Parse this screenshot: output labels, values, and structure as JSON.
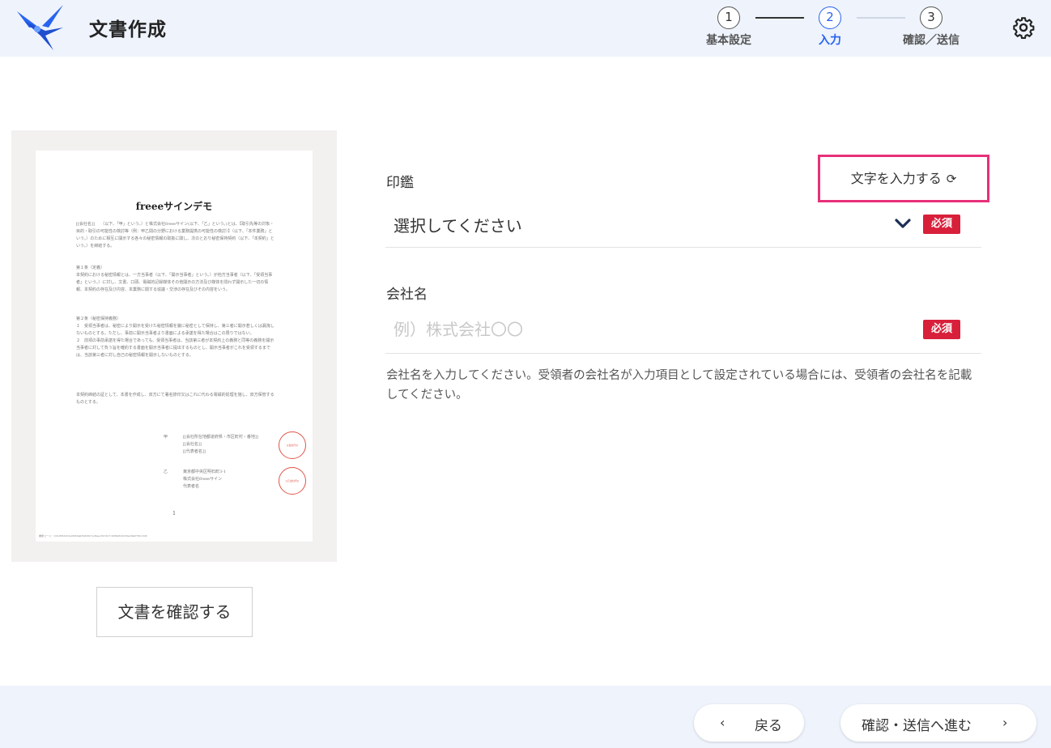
{
  "header": {
    "app_title": "文書作成",
    "steps": [
      {
        "number": "1",
        "label": "基本設定"
      },
      {
        "number": "2",
        "label": "入力"
      },
      {
        "number": "3",
        "label": "確認／送信"
      }
    ],
    "active_step": 2,
    "accent_color": "#2864f0"
  },
  "preview": {
    "doc_title": "freeeサインデモ",
    "paragraphs": [
      "[[会社名]]　　（以下、「甲」という。）と株式会社freeeサイン(以下、「乙」という。)とは、【取引先等の対象・目的・取引の可能性の検討等（例：甲乙間の分野における業務提携の可能性の検討）】（以下、「本件業務」という。）のために相互に開示する各々の秘密情報の取扱に関し、次のとおり秘密保持契約（以下、「本契約」という。）を締結する。",
      "第１条（定義）\n本契約における秘密情報とは、一方当事者（以下、「開示当事者」という。）が他方当事者（以下、「受領当事者」という。）に対し、文書、口頭、電磁的記録媒体その他開示の方法及び媒体を問わず開示した一切の情報、本契約の存在及び内容、本業務に関する協議・交渉の存在及びその内容をいう。",
      "第２条（秘密保持義務）\n１　受領当事者は、秘密により開示を受けた秘密情報を厳に秘密として保持し、第三者に開示若しくは漏洩しないものとする。ただし、事前に開示当事者より書面による承諾を得た場合はこの限りではない。\n２　前項の事前承諾を得た場合であっても、受領当事者は、当該第三者が本契約上の義務と同等の義務を開示当事者に対して負う旨を確約する書面を開示当事者に提出するものとし、開示当事者がこれを受領するまでは、当該第三者に対し自己の秘密情報を開示しないものとする。",
      "本契約締結の証として、本書を作成し、双方にて署名捺印又はこれに代わる電磁的処理を施し、双方保管するものとする。"
    ],
    "party_a_mark": "甲",
    "party_a_lines": [
      "[[会社所在地都道府県・市区町村・番地]]",
      "[[会社名]]",
      "[[代表者名]]"
    ],
    "party_b_mark": "乙",
    "party_b_lines": [
      "東京都中央区明石町3-1",
      "株式会社freeeサイン",
      "代表者名"
    ],
    "stamp_a_text": "[[会社印]]",
    "stamp_b_text": "[[乙会社印]]",
    "page_number": "1",
    "footer_id": "書類コード：10bc8f6d2b5e08f2fa4f3b8d6b7ed6eac8b7427c96f8a5b5d39a28a0f78bc6d6"
  },
  "confirm_doc_button": "文書を確認する",
  "form": {
    "seal": {
      "label": "印鑑",
      "type_text_button": "文字を入力する",
      "value": "選択してください",
      "required_badge": "必須"
    },
    "company": {
      "label": "会社名",
      "placeholder": "例）株式会社〇〇",
      "value": "",
      "required_badge": "必須",
      "help": "会社名を入力してください。受領者の会社名が入力項目として設定されている場合には、受領者の会社名を記載してください。"
    },
    "highlight_color": "#e8307a",
    "badge_color": "#d8203b"
  },
  "footer": {
    "back_label": "戻る",
    "next_label": "確認・送信へ進む"
  }
}
